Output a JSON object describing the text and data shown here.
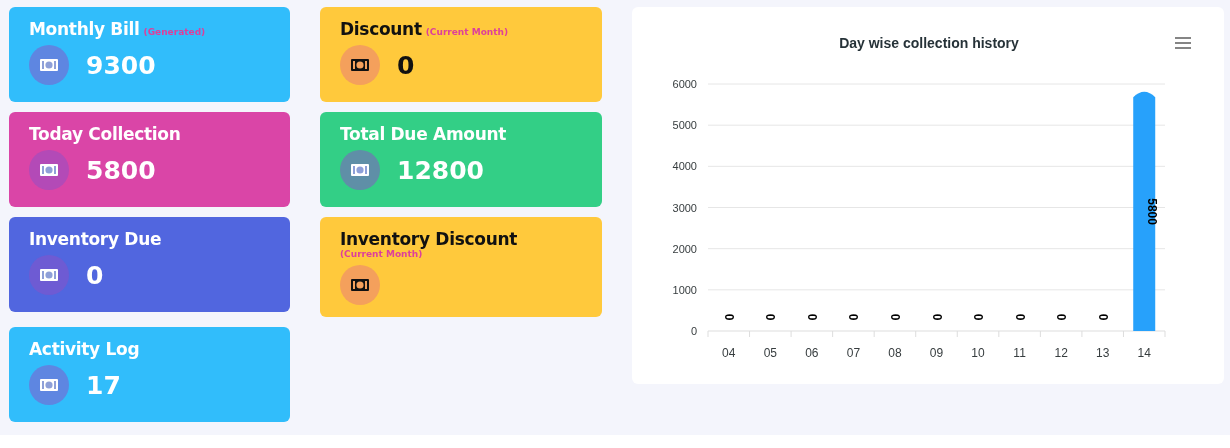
{
  "cards": [
    {
      "title": "Monthly Bill",
      "subtitle": "(Generated)",
      "value": "9300",
      "color": "#31bdfb"
    },
    {
      "title": "Discount",
      "subtitle": "(Current Month)",
      "value": "0",
      "color": "#ffc93c"
    },
    {
      "title": "Today Collection",
      "value": "5800",
      "color": "#da45a7"
    },
    {
      "title": "Total Due Amount",
      "value": "12800",
      "color": "#33cf86"
    },
    {
      "title": "Inventory Due",
      "value": "0",
      "color": "#5166df"
    },
    {
      "title": "Inventory Discount",
      "subtitle": "(Current Month)",
      "color": "#ffc93c"
    },
    {
      "title": "Activity Log",
      "value": "17",
      "color": "#31bdfb"
    }
  ],
  "chart": {
    "chart_data": {
      "type": "bar",
      "title": "Day wise collection history",
      "categories": [
        "04",
        "05",
        "06",
        "07",
        "08",
        "09",
        "10",
        "11",
        "12",
        "13",
        "14"
      ],
      "series": [
        {
          "color": "#27a1fb",
          "values": [
            0,
            0,
            0,
            0,
            0,
            0,
            0,
            0,
            0,
            0,
            5800
          ]
        }
      ],
      "ylim": [
        0,
        6000
      ],
      "yticks": [
        0,
        1000,
        2000,
        3000,
        4000,
        5000,
        6000
      ],
      "data_labels": true,
      "grid": true
    }
  }
}
